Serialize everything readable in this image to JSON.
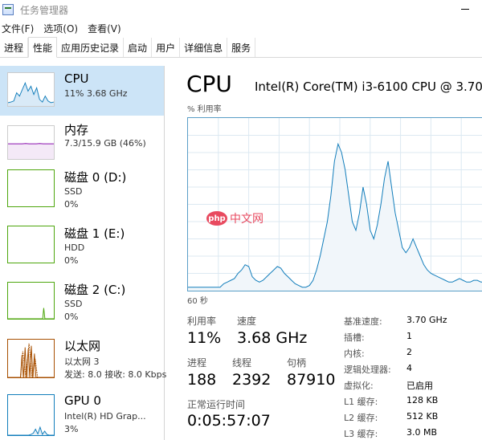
{
  "window": {
    "title": "任务管理器"
  },
  "menu": [
    "文件(F)",
    "选项(O)",
    "查看(V)"
  ],
  "tabs": [
    {
      "label": "进程",
      "active": false
    },
    {
      "label": "性能",
      "active": true
    },
    {
      "label": "应用历史记录",
      "active": false
    },
    {
      "label": "启动",
      "active": false
    },
    {
      "label": "用户",
      "active": false
    },
    {
      "label": "详细信息",
      "active": false
    },
    {
      "label": "服务",
      "active": false
    }
  ],
  "sidebar": {
    "items": [
      {
        "name": "CPU",
        "lines": [
          "11% 3.68 GHz"
        ],
        "selected": true
      },
      {
        "name": "内存",
        "lines": [
          "7.3/15.9 GB (46%)"
        ]
      },
      {
        "name": "磁盘 0 (D:)",
        "lines": [
          "SSD",
          "0%"
        ]
      },
      {
        "name": "磁盘 1 (E:)",
        "lines": [
          "HDD",
          "0%"
        ]
      },
      {
        "name": "磁盘 2 (C:)",
        "lines": [
          "SSD",
          "0%"
        ]
      },
      {
        "name": "以太网",
        "lines": [
          "以太网 3",
          "发送: 8.0 接收: 8.0 Kbps"
        ]
      },
      {
        "name": "GPU 0",
        "lines": [
          "Intel(R) HD Grap...",
          "3%"
        ]
      }
    ]
  },
  "main": {
    "title": "CPU",
    "model": "Intel(R) Core(TM) i3-6100 CPU @ 3.70GHz",
    "graph_label": "% 利用率",
    "time_label": "60 秒",
    "stats": [
      {
        "label": "利用率",
        "value": "11%"
      },
      {
        "label": "速度",
        "value": "3.68 GHz"
      },
      {
        "label": "进程",
        "value": "188"
      },
      {
        "label": "线程",
        "value": "2392"
      },
      {
        "label": "句柄",
        "value": "87910"
      },
      {
        "label": "正常运行时间",
        "value": "0:05:57:07"
      }
    ],
    "specs": [
      {
        "label": "基准速度:",
        "value": "3.70 GHz"
      },
      {
        "label": "插槽:",
        "value": "1"
      },
      {
        "label": "内核:",
        "value": "2"
      },
      {
        "label": "逻辑处理器:",
        "value": "4"
      },
      {
        "label": "虚拟化:",
        "value": "已启用"
      },
      {
        "label": "L1 缓存:",
        "value": "128 KB"
      },
      {
        "label": "L2 缓存:",
        "value": "512 KB"
      },
      {
        "label": "L3 缓存:",
        "value": "3.0 MB"
      }
    ]
  },
  "watermark": {
    "logo_text": "php",
    "text": "中文网"
  },
  "colors": {
    "cpu": "#117dbb",
    "memory": "#8b12ae",
    "disk": "#4da60c",
    "ethernet": "#a74f01",
    "selected_bg": "#cce4f7"
  },
  "cpu_history": [
    2,
    2,
    2,
    2,
    2,
    2,
    2,
    2,
    2,
    2,
    4,
    5,
    6,
    7,
    10,
    12,
    15,
    14,
    8,
    6,
    5,
    6,
    8,
    10,
    12,
    14,
    13,
    10,
    8,
    6,
    4,
    3,
    2,
    2,
    3,
    6,
    12,
    20,
    30,
    40,
    55,
    75,
    85,
    80,
    70,
    55,
    40,
    35,
    45,
    60,
    50,
    35,
    30,
    38,
    50,
    65,
    75,
    60,
    45,
    35,
    25,
    22,
    25,
    30,
    25,
    20,
    15,
    12,
    10,
    9,
    8,
    7,
    6,
    5,
    5,
    6,
    7,
    6,
    5,
    5,
    6,
    6,
    5,
    5,
    6,
    5
  ],
  "thumbs": {
    "cpu": [
      10,
      12,
      15,
      40,
      30,
      50,
      70,
      45,
      60,
      35,
      55,
      20,
      12,
      30,
      15,
      10,
      12
    ],
    "memory": [
      46,
      46,
      46,
      46,
      46,
      47,
      46,
      46,
      46,
      47,
      46,
      46,
      46,
      46
    ],
    "gpu": [
      0,
      0,
      0,
      0,
      0,
      0,
      0,
      0,
      0,
      0,
      2,
      5,
      15,
      3,
      20,
      2,
      10,
      2,
      0,
      0,
      0
    ],
    "disk2": [
      0,
      0,
      0,
      0,
      0,
      0,
      0,
      0,
      0,
      0,
      0,
      0,
      0,
      0,
      0,
      0,
      0,
      0,
      0,
      0,
      0,
      0,
      0,
      0,
      0,
      0,
      0,
      0,
      0,
      0,
      0,
      0,
      30,
      0,
      0,
      0,
      0,
      0,
      0,
      0,
      0,
      0
    ]
  }
}
